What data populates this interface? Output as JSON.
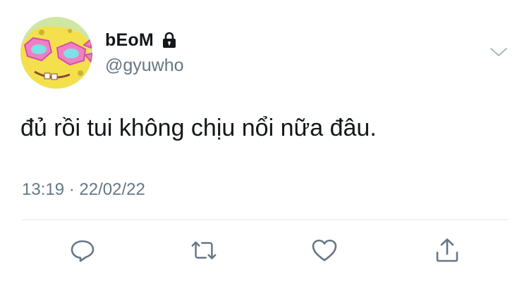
{
  "user": {
    "display_name": "bEoM",
    "handle": "@gyuwho",
    "protected": true,
    "avatar_icon": "spongebob-with-pink-glasses-avatar"
  },
  "tweet": {
    "text": "đủ rồi tui không chịu nổi nữa đâu.",
    "timestamp": "13:19 · 22/02/22"
  },
  "actions": {
    "reply_icon": "reply-icon",
    "retweet_icon": "retweet-icon",
    "like_icon": "heart-icon",
    "share_icon": "share-icon"
  },
  "colors": {
    "text": "#14171a",
    "secondary": "#657786",
    "divider": "#e1e8ed",
    "icon": "#657786"
  }
}
